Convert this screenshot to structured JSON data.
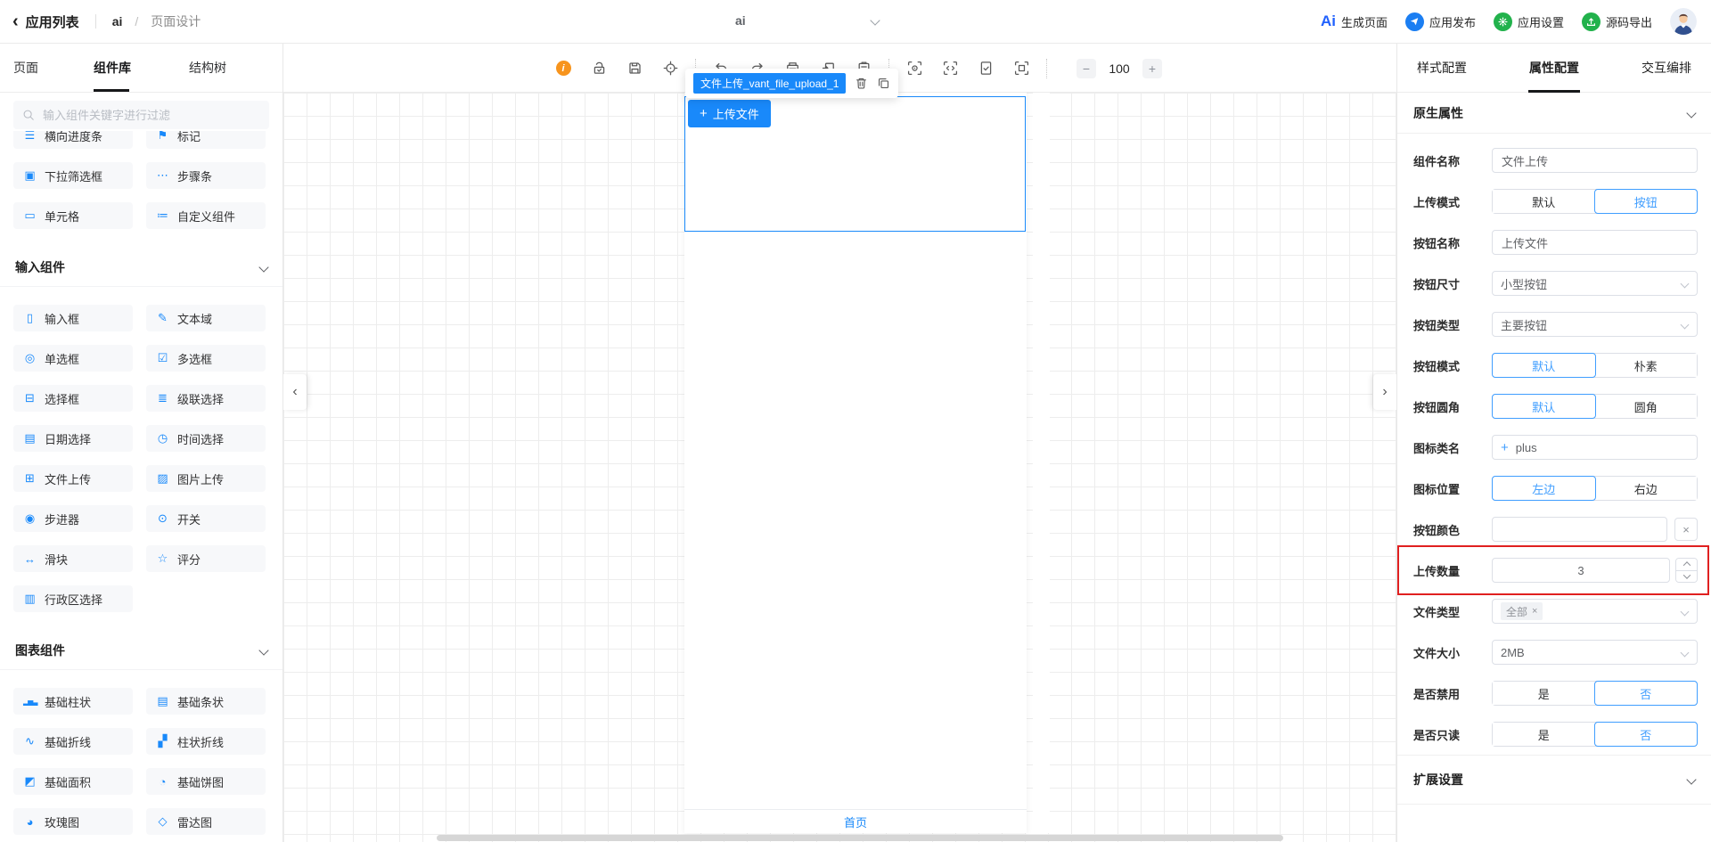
{
  "colors": {
    "primary": "#1989fa",
    "panel_accent": "#409eff",
    "highlight_red": "#e02020",
    "info_orange": "#f7941d",
    "action_green": "#22b24c",
    "action_blue": "#1b7ef2"
  },
  "header": {
    "back_chevron": "‹",
    "back_label": "应用列表",
    "breadcrumb": {
      "app": "ai",
      "separator": "/",
      "page": "页面设计"
    },
    "page_selector": "ai",
    "ai_logo_text": "Ai",
    "actions": [
      {
        "label": "生成页面"
      },
      {
        "label": "应用发布"
      },
      {
        "label": "应用设置"
      },
      {
        "label": "源码导出"
      }
    ]
  },
  "sidebar": {
    "tabs": [
      {
        "label": "页面"
      },
      {
        "label": "组件库"
      },
      {
        "label": "结构树"
      }
    ],
    "active_tab": "组件库",
    "search_placeholder": "输入组件关键字进行过滤",
    "misc_items": [
      {
        "icon": "☰",
        "label": "横向进度条"
      },
      {
        "icon": "⚑",
        "label": "标记"
      },
      {
        "icon": "▣",
        "label": "下拉筛选框"
      },
      {
        "icon": "⋯",
        "label": "步骤条"
      },
      {
        "icon": "▭",
        "label": "单元格"
      },
      {
        "icon": "≔",
        "label": "自定义组件"
      }
    ],
    "input_section": {
      "title": "输入组件",
      "items": [
        {
          "icon": "▯",
          "label": "输入框"
        },
        {
          "icon": "✎",
          "label": "文本域"
        },
        {
          "icon": "◎",
          "label": "单选框"
        },
        {
          "icon": "☑",
          "label": "多选框"
        },
        {
          "icon": "⊟",
          "label": "选择框"
        },
        {
          "icon": "≣",
          "label": "级联选择"
        },
        {
          "icon": "▤",
          "label": "日期选择"
        },
        {
          "icon": "◷",
          "label": "时间选择"
        },
        {
          "icon": "⊞",
          "label": "文件上传"
        },
        {
          "icon": "▨",
          "label": "图片上传"
        },
        {
          "icon": "◉",
          "label": "步进器"
        },
        {
          "icon": "⊙",
          "label": "开关"
        },
        {
          "icon": "↔",
          "label": "滑块"
        },
        {
          "icon": "☆",
          "label": "评分"
        },
        {
          "icon": "▥",
          "label": "行政区选择"
        }
      ]
    },
    "chart_section": {
      "title": "图表组件",
      "items": [
        {
          "icon": "▂▅▃",
          "label": "基础柱状"
        },
        {
          "icon": "▤",
          "label": "基础条状"
        },
        {
          "icon": "∿",
          "label": "基础折线"
        },
        {
          "icon": "▞",
          "label": "柱状折线"
        },
        {
          "icon": "◩",
          "label": "基础面积"
        },
        {
          "icon": "◔",
          "label": "基础饼图"
        },
        {
          "icon": "◕",
          "label": "玫瑰图"
        },
        {
          "icon": "◇",
          "label": "雷达图"
        }
      ]
    }
  },
  "canvas": {
    "zoom_minus": "−",
    "zoom_value": "100",
    "zoom_plus": "+",
    "info_glyph": "i",
    "tooltip_label": "文件上传_vant_file_upload_1",
    "upload_button": {
      "plus": "+",
      "label": "上传文件"
    },
    "tabbar_label": "首页",
    "collapse_left": "‹",
    "collapse_right": "›"
  },
  "panel": {
    "tabs": [
      {
        "label": "样式配置"
      },
      {
        "label": "属性配置"
      },
      {
        "label": "交互编排"
      }
    ],
    "active_tab": "属性配置",
    "native_title": "原生属性",
    "extend_title": "扩展设置",
    "fields": {
      "comp_name": {
        "label": "组件名称",
        "value": "文件上传"
      },
      "upload_mode": {
        "label": "上传模式",
        "options": [
          "默认",
          "按钮"
        ],
        "selected": "按钮"
      },
      "btn_name": {
        "label": "按钮名称",
        "value": "上传文件"
      },
      "btn_size": {
        "label": "按钮尺寸",
        "value": "小型按钮"
      },
      "btn_type": {
        "label": "按钮类型",
        "value": "主要按钮"
      },
      "btn_mode": {
        "label": "按钮模式",
        "options": [
          "默认",
          "朴素"
        ],
        "selected": "默认"
      },
      "btn_round": {
        "label": "按钮圆角",
        "options": [
          "默认",
          "圆角"
        ],
        "selected": "默认"
      },
      "icon_class": {
        "label": "图标类名",
        "plus": "+",
        "value": "plus"
      },
      "icon_pos": {
        "label": "图标位置",
        "options": [
          "左边",
          "右边"
        ],
        "selected": "左边"
      },
      "btn_color": {
        "label": "按钮颜色",
        "value": "",
        "clear": "×"
      },
      "upload_count": {
        "label": "上传数量",
        "value": "3"
      },
      "file_type": {
        "label": "文件类型",
        "tag": "全部",
        "tag_close": "×"
      },
      "file_size": {
        "label": "文件大小",
        "value": "2MB"
      },
      "disabled": {
        "label": "是否禁用",
        "options": [
          "是",
          "否"
        ],
        "selected": "否"
      },
      "readonly": {
        "label": "是否只读",
        "options": [
          "是",
          "否"
        ],
        "selected": "否"
      }
    }
  }
}
